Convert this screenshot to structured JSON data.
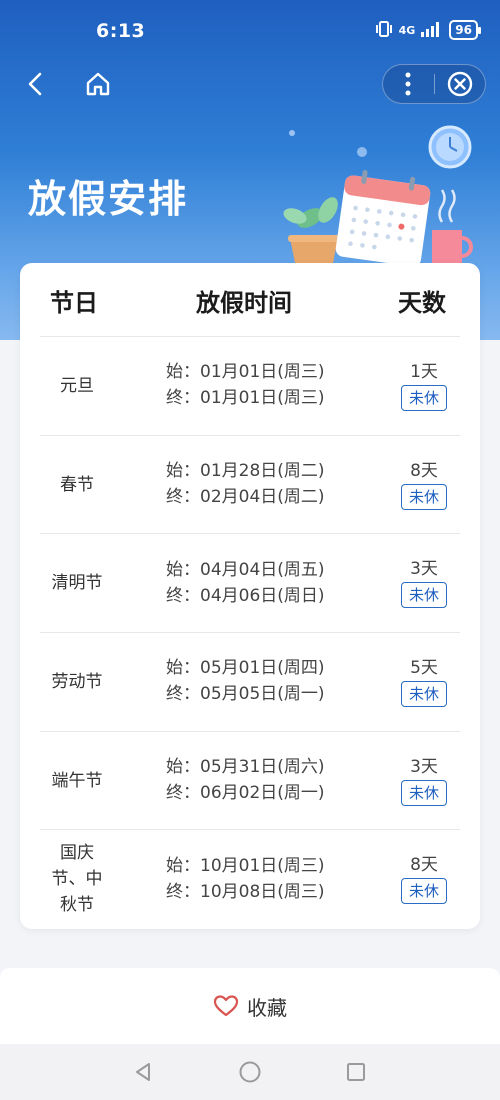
{
  "status_bar": {
    "time": "6:13",
    "network": "4G",
    "battery": "96"
  },
  "page": {
    "title": "放假安排"
  },
  "table": {
    "headers": {
      "holiday": "节日",
      "period": "放假时间",
      "days": "天数"
    },
    "rows": [
      {
        "name": "元旦",
        "start": "始：01月01日(周三)",
        "end": "终：01月01日(周三)",
        "days": "1天",
        "status": "未休"
      },
      {
        "name": "春节",
        "start": "始：01月28日(周二)",
        "end": "终：02月04日(周二)",
        "days": "8天",
        "status": "未休"
      },
      {
        "name": "清明节",
        "start": "始：04月04日(周五)",
        "end": "终：04月06日(周日)",
        "days": "3天",
        "status": "未休"
      },
      {
        "name": "劳动节",
        "start": "始：05月01日(周四)",
        "end": "终：05月05日(周一)",
        "days": "5天",
        "status": "未休"
      },
      {
        "name": "端午节",
        "start": "始：05月31日(周六)",
        "end": "终：06月02日(周一)",
        "days": "3天",
        "status": "未休"
      },
      {
        "name": "国庆\n节、中\n秋节",
        "start": "始：10月01日(周三)",
        "end": "终：10月08日(周三)",
        "days": "8天",
        "status": "未休"
      }
    ]
  },
  "bottom_bar": {
    "collect_label": "收藏"
  },
  "icons": {
    "back": "back-arrow-icon",
    "home": "home-icon",
    "more": "more-vertical-icon",
    "close": "close-circle-icon",
    "heart": "heart-icon",
    "clock": "clock-icon",
    "calendar": "calendar-icon",
    "cup": "cup-icon",
    "plant": "plant-icon"
  },
  "colors": {
    "hero_top": "#1f5fbf",
    "hero_bottom": "#86b9ef",
    "badge_blue": "#1f5fbf",
    "heart": "#d9534f"
  }
}
